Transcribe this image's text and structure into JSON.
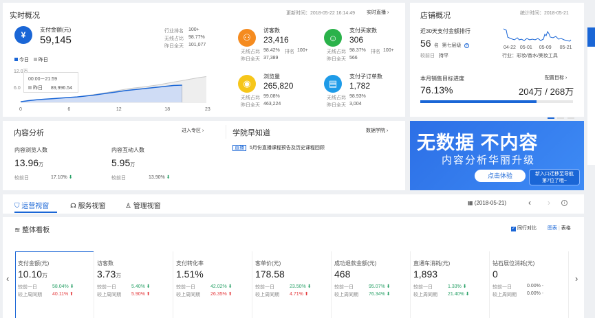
{
  "realtime": {
    "title": "实时概况",
    "update_time": "更新时间：2018-05-22 16:14:49",
    "live_link": "实时直播",
    "pay": {
      "name": "支付金额(元)",
      "value": "59,145",
      "rows": [
        [
          "行业排名",
          "100+"
        ],
        [
          "无线占比",
          "98.77%"
        ],
        [
          "昨日全天",
          "101,077"
        ]
      ]
    },
    "legend": {
      "today": "今日",
      "yesterday": "昨日"
    },
    "tooltip": {
      "time": "00:00－21:59",
      "yesterday_label": "昨日",
      "yesterday_value": "89,996.54"
    },
    "metrics": [
      {
        "name": "访客数",
        "value": "23,416",
        "r1l": "无线占比",
        "r1v": "98.42%",
        "r1l2": "排名",
        "r1v2": "100+",
        "r2l": "昨日全天",
        "r2v": "37,389",
        "color": "#f58b1f",
        "icon": "visitor-icon"
      },
      {
        "name": "支付买家数",
        "value": "306",
        "r1l": "无线占比",
        "r1v": "98.37%",
        "r1l2": "排名",
        "r1v2": "100+",
        "r2l": "昨日全天",
        "r2v": "566",
        "color": "#2ab24a",
        "icon": "buyer-icon"
      },
      {
        "name": "浏览量",
        "value": "265,820",
        "r1l": "无线占比",
        "r1v": "99.08%",
        "r1l2": "",
        "r1v2": "",
        "r2l": "昨日全天",
        "r2v": "463,224",
        "color": "#f6c61a",
        "icon": "eye-icon"
      },
      {
        "name": "支付子订单数",
        "value": "1,782",
        "r1l": "无线占比",
        "r1v": "98.93%",
        "r1l2": "",
        "r1v2": "",
        "r2l": "昨日全天",
        "r2v": "3,004",
        "color": "#1e9be8",
        "icon": "order-icon"
      }
    ]
  },
  "chart_data": {
    "type": "area",
    "x_ticks": [
      "0",
      "6",
      "12",
      "18",
      "23"
    ],
    "y_ticks": [
      "12.0万",
      "6.0"
    ],
    "series": [
      {
        "name": "今日",
        "values": [
          0.2,
          0.6,
          0.9,
          1.1,
          1.3,
          1.5,
          1.7,
          1.9,
          2.2,
          2.5,
          2.9,
          3.3,
          3.7,
          4.1,
          4.4,
          4.7,
          5.0,
          5.3,
          5.6,
          5.9,
          6.0
        ]
      },
      {
        "name": "昨日",
        "values": [
          0.2,
          0.5,
          0.8,
          1.0,
          1.2,
          1.4,
          1.7,
          1.9,
          2.3,
          2.7,
          3.1,
          3.6,
          4.1,
          4.6,
          5.0,
          5.3,
          5.7,
          6.1,
          6.6,
          7.1,
          7.6,
          8.1,
          8.6,
          9.0
        ]
      }
    ],
    "ylim": [
      0,
      12
    ]
  },
  "shop": {
    "title": "店铺概况",
    "stats_date": "统计时间：2018-05-21",
    "rank_title": "近30天支付金额排行",
    "rank_num": "56",
    "rank_unit": "名",
    "tier": "第七层级",
    "compare_label": "较前日",
    "compare_value": "持平",
    "mini_ticks": [
      "04-22",
      "05-01",
      "05-09",
      "05-21"
    ],
    "industry": "行业：彩妆/香水/美妆工具",
    "sales_title": "本月销售目标进度",
    "config_link": "配置目标",
    "progress_pct": "76.13%",
    "progress_value": 0.7613,
    "progress_current": "204万",
    "progress_sep": "/",
    "progress_target": "268万"
  },
  "content": {
    "title": "内容分析",
    "enter_link": "进入专区",
    "m1": {
      "name": "内容浏览人数",
      "value": "13.96",
      "unit": "万",
      "cmp": "较前日",
      "pct": "17.10%"
    },
    "m2": {
      "name": "内容互动人数",
      "value": "5.95",
      "unit": "万",
      "cmp": "较前日",
      "pct": "13.90%"
    }
  },
  "school": {
    "title": "学院早知道",
    "link": "数据学院",
    "tag": "直播",
    "text": "5月份直播课程预告及历史课程回顾"
  },
  "banner": {
    "line1": "无数据 不内容",
    "line2": "内容分析华丽升级",
    "btn": "点击体验",
    "note1": "新入口迁移至导航",
    "note2": "第7位了哦~"
  },
  "tabs": {
    "t1": "运营视窗",
    "t2": "服务视窗",
    "t3": "管理视窗",
    "date": "(2018-05-21)"
  },
  "board": {
    "title": "整体看板",
    "compare": "同行对比",
    "view_chart": "图表",
    "sep": "|",
    "view_table": "表格",
    "kpis": [
      {
        "name": "支付金额(元)",
        "value": "10.10",
        "unit": "万",
        "r1": "较前一日",
        "p1": "58.04%",
        "d1": "down",
        "r2": "较上周同期",
        "p2": "40.11%",
        "d2": "up"
      },
      {
        "name": "访客数",
        "value": "3.73",
        "unit": "万",
        "r1": "较前一日",
        "p1": "5.40%",
        "d1": "down",
        "r2": "较上周同期",
        "p2": "5.90%",
        "d2": "up"
      },
      {
        "name": "支付转化率",
        "value": "1.51%",
        "unit": "",
        "r1": "较前一日",
        "p1": "42.02%",
        "d1": "down",
        "r2": "较上周同期",
        "p2": "26.35%",
        "d2": "up"
      },
      {
        "name": "客单价(元)",
        "value": "178.58",
        "unit": "",
        "r1": "较前一日",
        "p1": "23.50%",
        "d1": "down",
        "r2": "较上周同期",
        "p2": "4.71%",
        "d2": "up"
      },
      {
        "name": "成功退款金额(元)",
        "value": "468",
        "unit": "",
        "r1": "较前一日",
        "p1": "95.07%",
        "d1": "down",
        "r2": "较上周同期",
        "p2": "76.34%",
        "d2": "down"
      },
      {
        "name": "直通车消耗(元)",
        "value": "1,893",
        "unit": "",
        "r1": "较前一日",
        "p1": "1.33%",
        "d1": "down",
        "r2": "较上周同期",
        "p2": "21.40%",
        "d2": "down"
      },
      {
        "name": "钻石展位消耗(元)",
        "value": "0",
        "unit": "",
        "r1": "较前一日",
        "p1": "0.00%",
        "d1": "none",
        "r2": "较上周同期",
        "p2": "0.00%",
        "d2": "none"
      }
    ]
  }
}
